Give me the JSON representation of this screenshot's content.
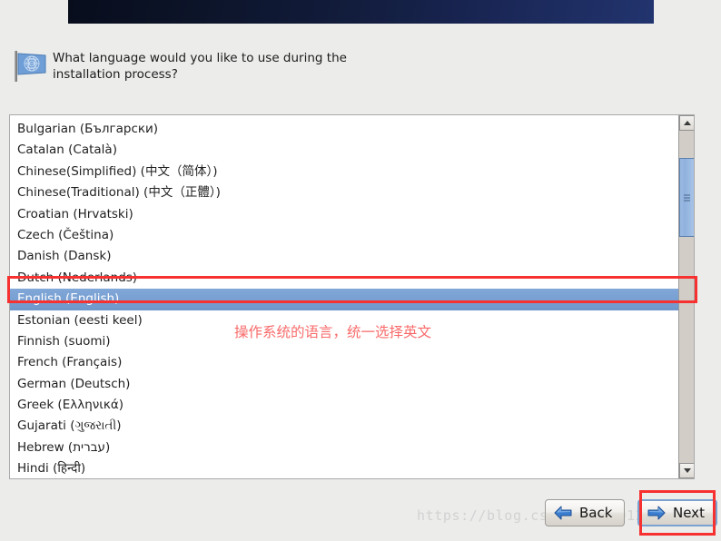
{
  "window": {
    "background_color": "#ececeb",
    "banner_color_left": "#080d1c",
    "banner_color_right": "#22346e"
  },
  "header": {
    "icon": "un-flag-icon",
    "question": "What language would you like to use during the installation process?"
  },
  "language_list": {
    "selected": "English (English)",
    "items": [
      "Bulgarian (Български)",
      "Catalan (Català)",
      "Chinese(Simplified) (中文（简体）)",
      "Chinese(Traditional) (中文（正體）)",
      "Croatian (Hrvatski)",
      "Czech (Čeština)",
      "Danish (Dansk)",
      "Dutch (Nederlands)",
      "English (English)",
      "Estonian (eesti keel)",
      "Finnish (suomi)",
      "French (Français)",
      "German (Deutsch)",
      "Greek (Ελληνικά)",
      "Gujarati (ગુજરાતી)",
      "Hebrew (עברית)",
      "Hindi (हिन्दी)"
    ]
  },
  "scrollbar": {
    "up_arrow": "chevron-up-icon",
    "down_arrow": "chevron-down-icon",
    "thumb_color": "#8fb1dd"
  },
  "annotations": {
    "highlight_color": "#f73030",
    "note_text": "操作系统的语言，统一选择英文",
    "note_color": "#f96a6a"
  },
  "watermark": {
    "text": "https://blog.csdn.net/u012526411"
  },
  "buttons": {
    "back_label": "Back",
    "back_icon": "arrow-left-icon",
    "next_label": "Next",
    "next_icon": "arrow-right-icon",
    "arrow_color": "#2f6fc4"
  }
}
